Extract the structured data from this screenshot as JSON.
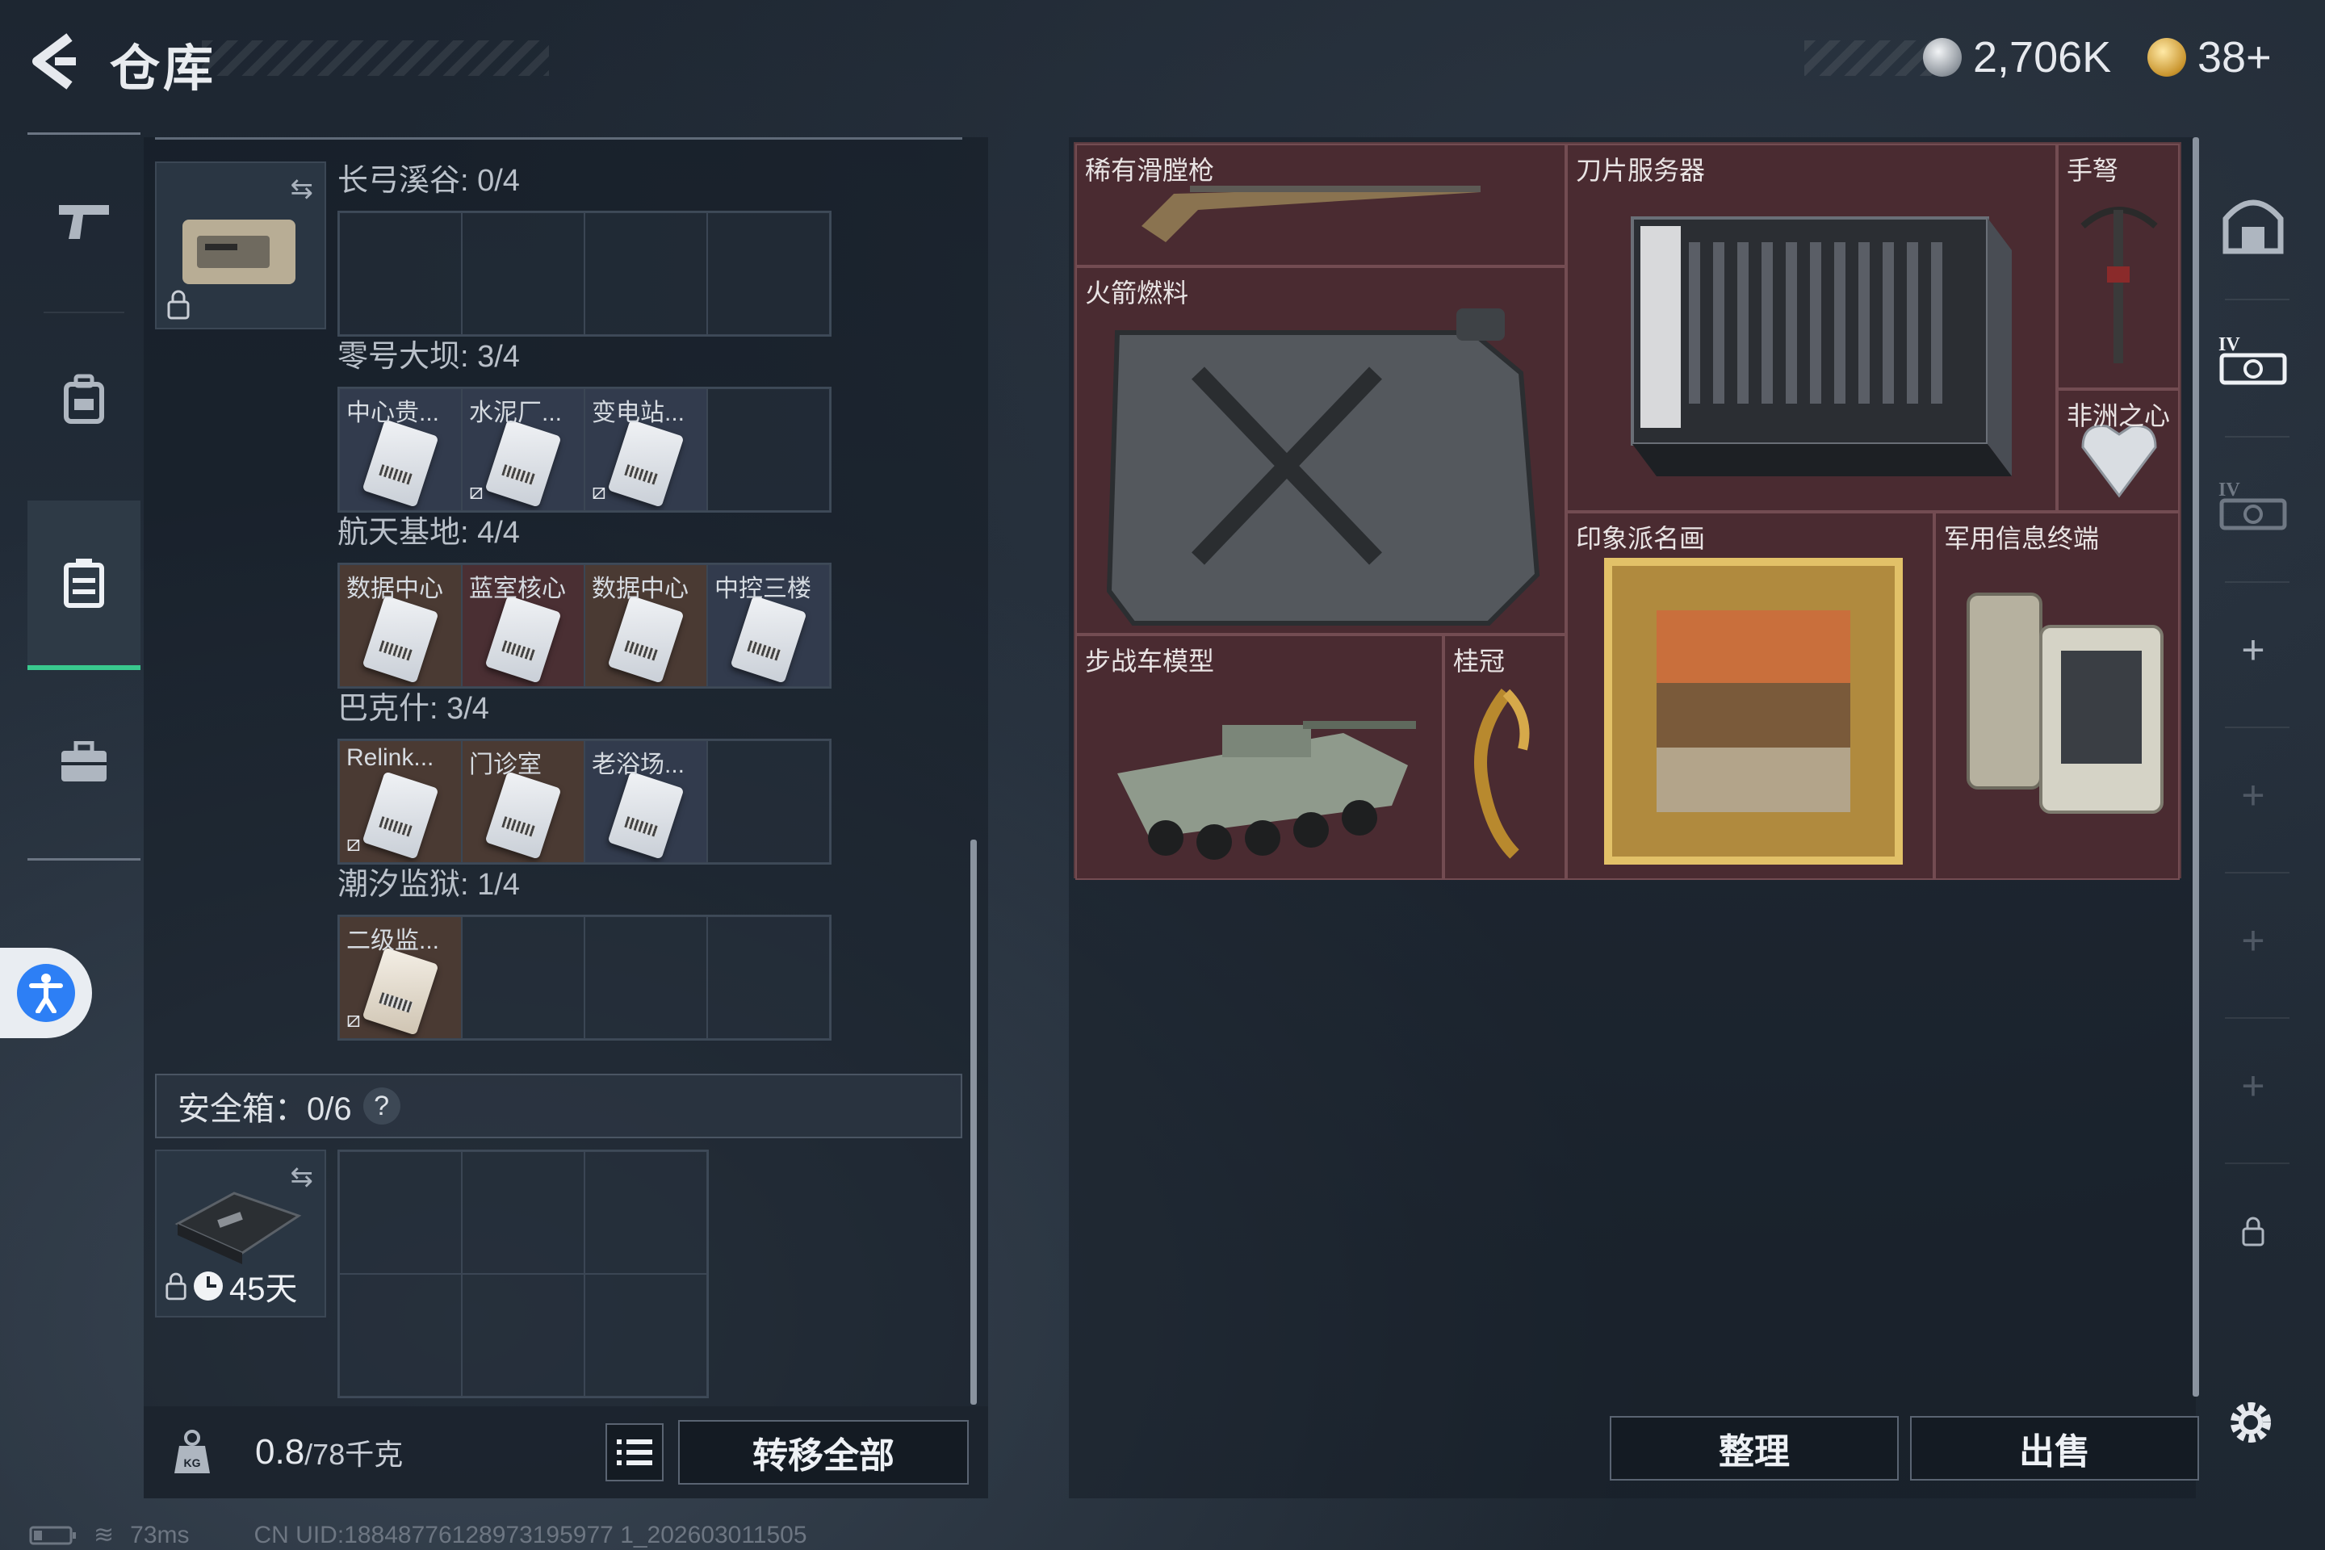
{
  "header": {
    "title": "仓库",
    "currency_silver": "2,706K",
    "currency_gold": "38+",
    "silver_color": "#c9ced6",
    "gold_color": "#d9b24a"
  },
  "nav": {
    "items": [
      "gun-icon",
      "backpack-icon",
      "container-icon",
      "briefcase-icon"
    ],
    "active_index": 2
  },
  "container": {
    "time_left": "45天",
    "sections": [
      {
        "label": "长弓溪谷: 0/4",
        "rows": 1,
        "cells": []
      },
      {
        "label": "零号大坝: 3/4",
        "rows": 1,
        "cells": [
          {
            "name": "中心贵...",
            "rarity": "r-blue",
            "no_swap": false
          },
          {
            "name": "水泥厂...",
            "rarity": "r-blue",
            "no_swap": true
          },
          {
            "name": "变电站...",
            "rarity": "r-blue",
            "no_swap": true
          }
        ]
      },
      {
        "label": "航天基地: 4/4",
        "rows": 1,
        "cells": [
          {
            "name": "数据中心",
            "rarity": "r-brown",
            "no_swap": false
          },
          {
            "name": "蓝室核心",
            "rarity": "r-red",
            "no_swap": false
          },
          {
            "name": "数据中心",
            "rarity": "r-brown",
            "no_swap": false
          },
          {
            "name": "中控三楼",
            "rarity": "r-blue",
            "no_swap": false
          }
        ]
      },
      {
        "label": "巴克什: 3/4",
        "rows": 1,
        "cells": [
          {
            "name": "Relink...",
            "rarity": "r-brown",
            "no_swap": true
          },
          {
            "name": "门诊室",
            "rarity": "r-brown",
            "no_swap": false
          },
          {
            "name": "老浴场...",
            "rarity": "r-blue",
            "no_swap": false
          }
        ]
      },
      {
        "label": "潮汐监狱: 1/4",
        "rows": 1,
        "cells": [
          {
            "name": "二级监...",
            "rarity": "r-brown",
            "no_swap": true
          }
        ]
      }
    ]
  },
  "safebox": {
    "label": "安全箱：0/6",
    "help": "?"
  },
  "footer_left": {
    "weight_current": "0.8",
    "weight_max": "/78千克",
    "transfer_all": "转移全部"
  },
  "stash": {
    "items": [
      {
        "name": "稀有滑膛枪"
      },
      {
        "name": "刀片服务器"
      },
      {
        "name": "手弩"
      },
      {
        "name": "火箭燃料"
      },
      {
        "name": "非洲之心"
      },
      {
        "name": "印象派名画"
      },
      {
        "name": "军用信息终端"
      },
      {
        "name": "步战车模型"
      },
      {
        "name": "桂冠"
      }
    ]
  },
  "footer_right": {
    "sort": "整理",
    "sell": "出售"
  },
  "rail": {
    "items": [
      "locker-icon",
      "storage-iv-icon",
      "storage-iv-icon",
      "plus-icon",
      "plus-icon",
      "plus-icon",
      "plus-icon",
      "lock-icon"
    ]
  },
  "status_bar": {
    "ping": "73ms",
    "uid": "CN UID:18848776128973195977 1_202603011505"
  }
}
